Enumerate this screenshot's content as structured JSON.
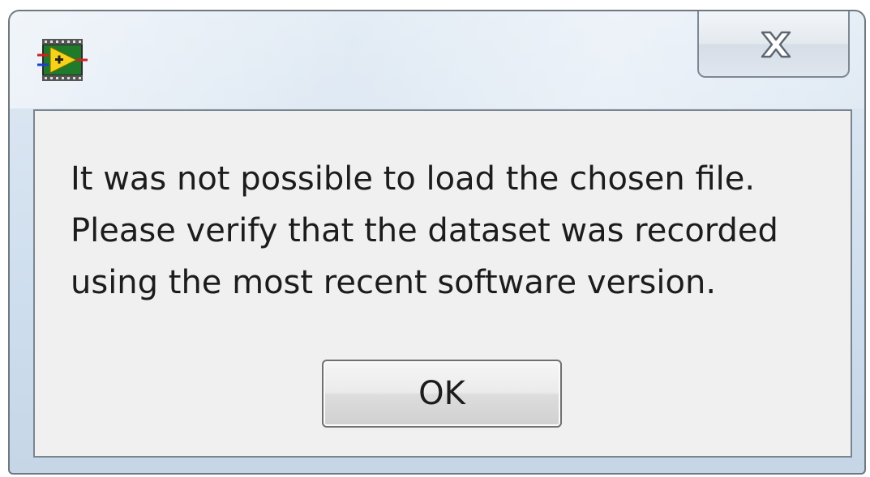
{
  "dialog": {
    "app_icon": "labview-vi-icon",
    "close_icon": "close-x-icon",
    "message_lines": [
      "It was not possible to load the chosen file.",
      "Please verify that the dataset was recorded",
      "using the most recent software version."
    ],
    "ok_label": "OK"
  },
  "colors": {
    "titlebar": "#cfdeee",
    "content_background": "#f0f0f0",
    "text": "#1c1c1c"
  }
}
